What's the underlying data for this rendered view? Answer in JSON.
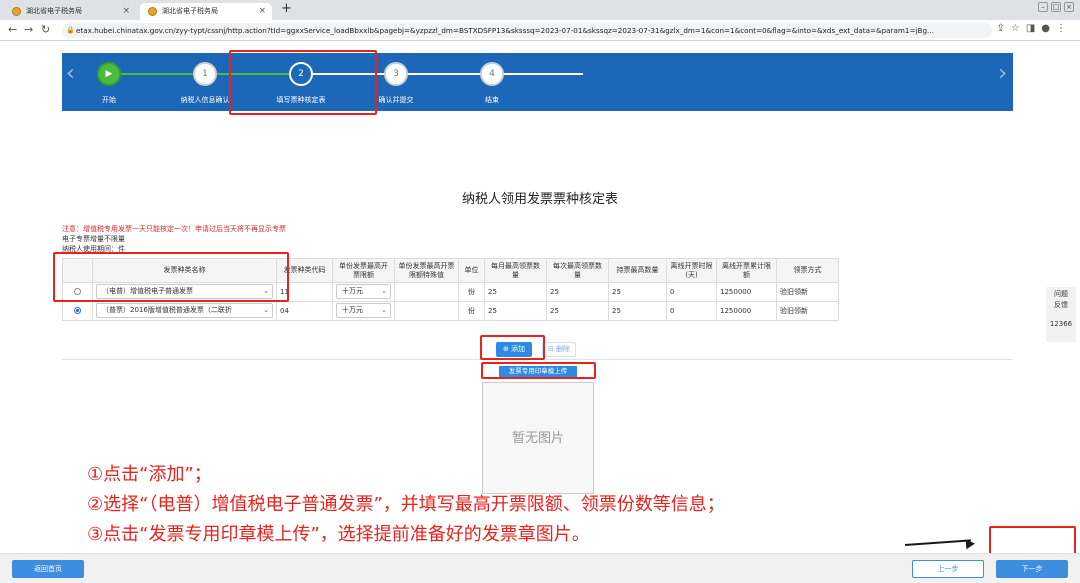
{
  "browser": {
    "tabs": [
      {
        "title": "湖北省电子税务局",
        "close": "×"
      },
      {
        "title": "湖北省电子税务局",
        "close": "×"
      }
    ],
    "new_tab": "+",
    "url": "etax.hubei.chinatax.gov.cn/zyy-typt/cssnj/http.action?tId=ggxxService_loadBbxxlb&pagebj=&yzpzzl_dm=BSTXDSFP13&sksssq=2023-07-01&skssqz=2023-07-31&gzlx_dm=1&con=1&cont=0&flag=&into=&xds_ext_data=&param1=jBg..."
  },
  "stepper": {
    "steps": [
      {
        "num": "▶",
        "label": "开始"
      },
      {
        "num": "1",
        "label": "纳税人信息确认"
      },
      {
        "num": "2",
        "label": "填写票种核定表"
      },
      {
        "num": "3",
        "label": "确认并提交"
      },
      {
        "num": "4",
        "label": "结束"
      }
    ],
    "current_index": 2
  },
  "form": {
    "title": "纳税人领用发票票种核定表",
    "notes": [
      "注意：增值税专用发票一天只能核定一次！申请过后当天将不再显示专票",
      "电子专票增量不限量",
      "纳税人使用期间：件"
    ],
    "table": {
      "headers": [
        "",
        "发票种类名称",
        "发票种类代码",
        "单份发票最高开票限额",
        "单份发票最高开票限额特殊值",
        "单位",
        "每月最高领票数量",
        "每次最高领票数量",
        "持票最高数量",
        "离线开票时限(天)",
        "离线开票累计限额",
        "领票方式"
      ],
      "rows": [
        {
          "selected": false,
          "name": "（电普）增值税电子普通发票",
          "code": "11",
          "limit": "十万元",
          "special": "",
          "unit": "份",
          "monthly": "25",
          "per_time": "25",
          "hold": "25",
          "offline_days": "0",
          "offline_total": "1250000",
          "method": "验旧领新"
        },
        {
          "selected": true,
          "name": "（普票）2016版增值税普通发票（二联折",
          "code": "04",
          "limit": "十万元",
          "special": "",
          "unit": "份",
          "monthly": "25",
          "per_time": "25",
          "hold": "25",
          "offline_days": "0",
          "offline_total": "1250000",
          "method": "验旧领新"
        }
      ]
    },
    "add_button": "添加",
    "delete_button": "删除",
    "upload_button": "发票专用印章模上传",
    "no_image": "暂无图片"
  },
  "side_panel": {
    "line1": "问题",
    "line2": "反馈",
    "hotline": "12366"
  },
  "instructions": [
    "①点击“添加”；",
    "②选择“（电普）增值税电子普通发票”，并填写最高开票限额、领票份数等信息；",
    "③点击“发票专用印章模上传”，选择提前准备好的发票章图片。"
  ],
  "footer": {
    "home": "返回首页",
    "prev": "上一步",
    "next": "下一步"
  },
  "colors": {
    "primary": "#1d67b9",
    "accent": "#2d8be3",
    "highlight": "#e8221d",
    "done": "#4cbb3e"
  }
}
